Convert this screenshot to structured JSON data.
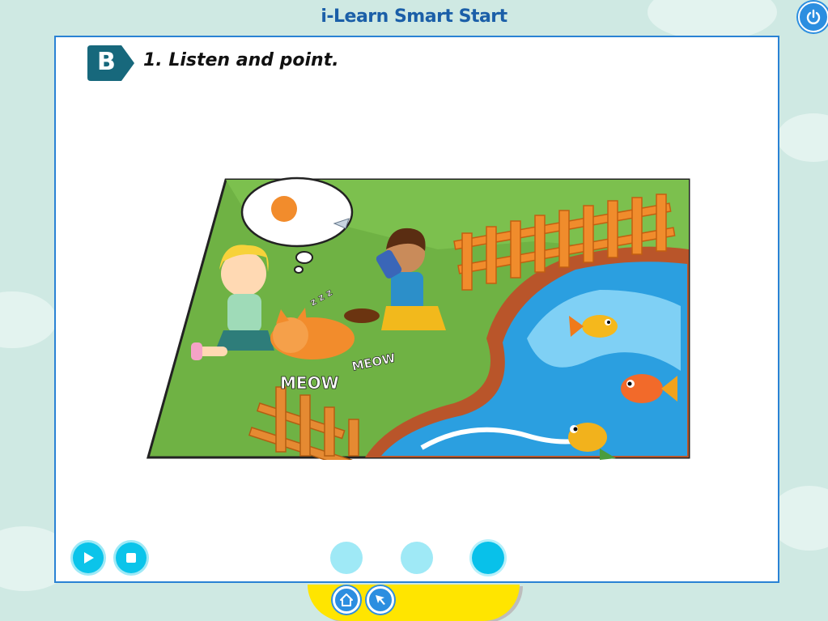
{
  "app": {
    "title": "i-Learn Smart Start"
  },
  "exercise": {
    "section_letter": "B",
    "instruction": "1. Listen and point."
  },
  "scene": {
    "caption_meow_1": "MEOW",
    "caption_meow_2": "MEOW",
    "caption_zzz": "z z z"
  },
  "controls": {
    "play_icon": "play-icon",
    "stop_icon": "stop-icon",
    "track_dots": [
      {
        "state": "inactive",
        "color": "#9fe9f6"
      },
      {
        "state": "inactive",
        "color": "#9fe9f6"
      },
      {
        "state": "active",
        "color": "#08c1ea"
      }
    ]
  },
  "footer": {
    "home_icon": "home-icon",
    "back_icon": "back-arrow-icon"
  },
  "colors": {
    "brand_blue": "#2a82d4",
    "accent_cyan": "#0bc4ea",
    "footer_yellow": "#ffe500"
  }
}
